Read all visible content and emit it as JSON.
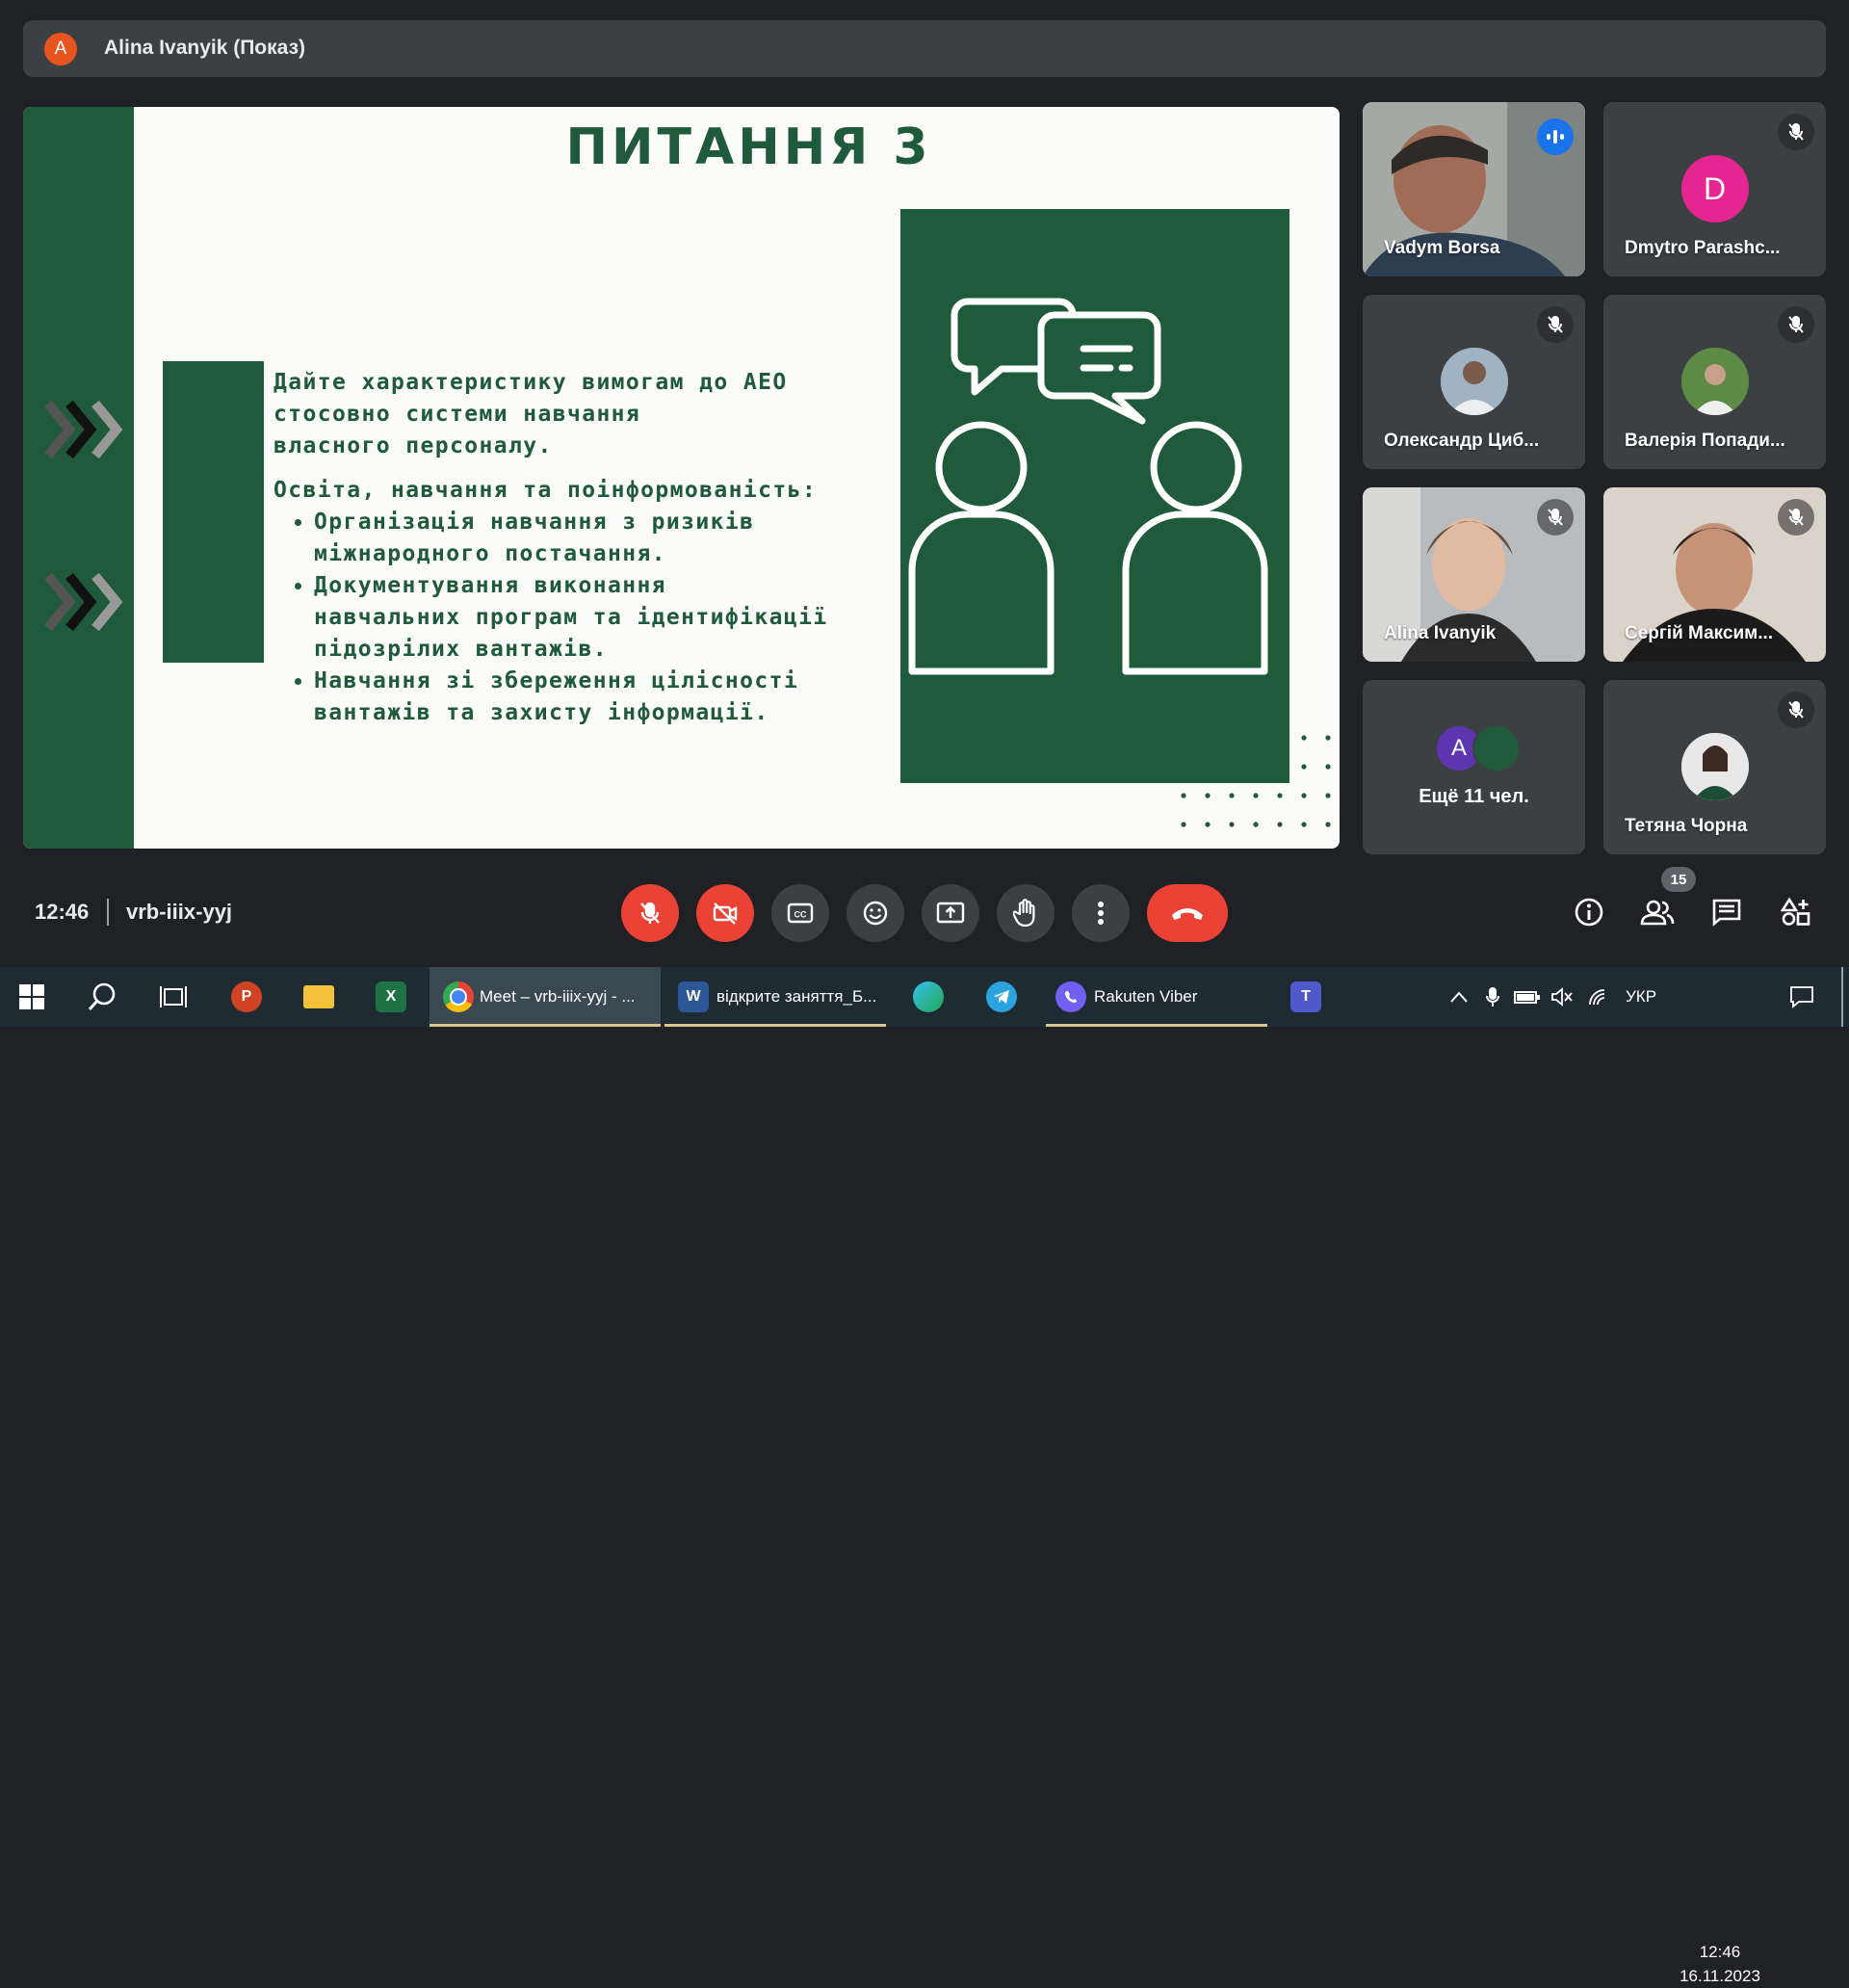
{
  "presenter": {
    "avatar_letter": "A",
    "title": "Alina Ivanyik (Показ)"
  },
  "slide": {
    "title": "ПИТАННЯ 3",
    "intro": [
      "Дайте характеристику вимогам до АЕО",
      "стосовно системи навчання",
      "власного персоналу."
    ],
    "subheading": "Освіта, навчання та поінформованість:",
    "bullets": [
      [
        "Організація навчання з ризиків",
        "міжнародного постачання."
      ],
      [
        "Документування виконання",
        "навчальних програм та ідентифікації",
        "підозрілих вантажів."
      ],
      [
        "Навчання зі збереження цілісності",
        "вантажів та захисту інформації."
      ]
    ],
    "colors": {
      "green": "#1f5a3a",
      "background": "#fbfbfa"
    }
  },
  "participants": [
    {
      "name": "Vadym Borsa",
      "state": "speaking",
      "icon": "audio-level-icon"
    },
    {
      "name": "Dmytro Parashc...",
      "avatar_letter": "D",
      "avatar_color": "#e52592",
      "state": "muted"
    },
    {
      "name": "Олександр Циб...",
      "state": "muted"
    },
    {
      "name": "Валерія Попади...",
      "state": "muted"
    },
    {
      "name": "Alina Ivanyik",
      "state": "muted"
    },
    {
      "name": "Сергій Максим...",
      "state": "muted"
    },
    {
      "name": "Ещё 11 чел.",
      "avatar_letter": "A",
      "avatar_color": "#5e35b1"
    },
    {
      "name": "Тетяна Чорна",
      "state": "muted"
    }
  ],
  "meeting": {
    "time": "12:46",
    "code": "vrb-iiix-yyj",
    "participant_count": "15"
  },
  "controls": [
    "mic-off-icon",
    "camera-off-icon",
    "captions-icon",
    "emoji-icon",
    "present-screen-icon",
    "raise-hand-icon",
    "more-options-icon",
    "leave-call-icon"
  ],
  "taskbar": {
    "tabs": [
      "Meet – vrb-iiix-yyj - ...",
      "відкрите заняття_Б...",
      "Rakuten Viber"
    ],
    "lang": "УКР",
    "clock_time": "12:46",
    "clock_date": "16.11.2023"
  }
}
